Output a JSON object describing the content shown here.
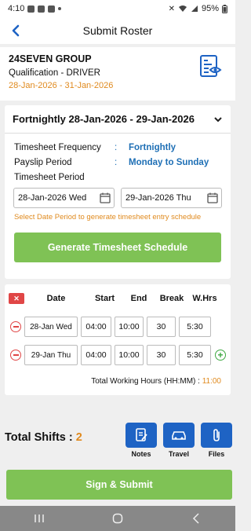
{
  "status_bar": {
    "time": "4:10",
    "battery": "95%"
  },
  "header": {
    "title": "Submit Roster"
  },
  "company": {
    "name": "24SEVEN GROUP",
    "qualification": "Qualification -  DRIVER",
    "date_range": "28-Jan-2026 - 31-Jan-2026"
  },
  "period": {
    "title": "Fortnightly 28-Jan-2026 - 29-Jan-2026",
    "info": [
      {
        "label": "Timesheet Frequency",
        "value": "Fortnightly"
      },
      {
        "label": "Payslip Period",
        "value": "Monday to Sunday"
      },
      {
        "label": "Timesheet Period",
        "value": ""
      }
    ],
    "from_date": "28-Jan-2026 Wed",
    "to_date": "29-Jan-2026 Thu",
    "hint": "Select Date Period to generate timesheet entry schedule",
    "generate_label": "Generate Timesheet Schedule"
  },
  "table": {
    "headers": {
      "date": "Date",
      "start": "Start",
      "end": "End",
      "break": "Break",
      "whrs": "W.Hrs"
    },
    "rows": [
      {
        "date": "28-Jan Wed",
        "start": "04:00",
        "end": "10:00",
        "break": "30",
        "whrs": "5:30"
      },
      {
        "date": "29-Jan Thu",
        "start": "04:00",
        "end": "10:00",
        "break": "30",
        "whrs": "5:30"
      }
    ],
    "total_label": "Total Working Hours (HH:MM) : ",
    "total_value": "11:00"
  },
  "summary": {
    "shifts_label": "Total Shifts : ",
    "shifts_count": "2"
  },
  "actions": {
    "notes": "Notes",
    "travel": "Travel",
    "files": "Files"
  },
  "submit_label": "Sign & Submit",
  "colors": {
    "accent_blue": "#1e63c4",
    "green": "#7fc255",
    "orange": "#e08a1e",
    "red": "#e04646"
  }
}
